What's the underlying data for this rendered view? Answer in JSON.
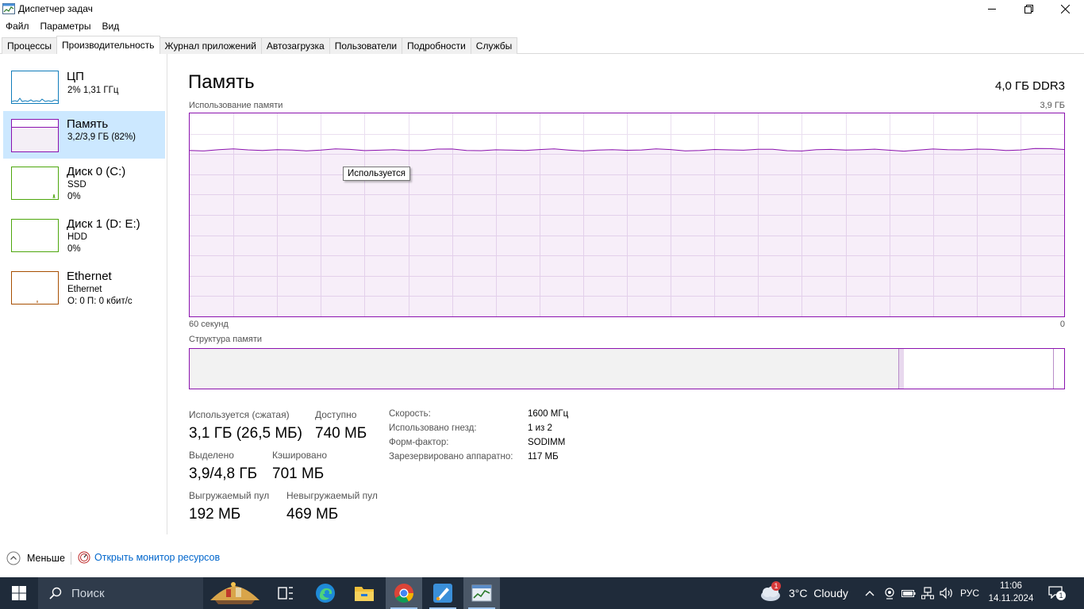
{
  "window": {
    "title": "Диспетчер задач",
    "controls": [
      "minimize-icon",
      "restore-icon",
      "close-icon"
    ]
  },
  "menu": [
    "Файл",
    "Параметры",
    "Вид"
  ],
  "tabs": [
    {
      "label": "Процессы",
      "active": false
    },
    {
      "label": "Производительность",
      "active": true
    },
    {
      "label": "Журнал приложений",
      "active": false
    },
    {
      "label": "Автозагрузка",
      "active": false
    },
    {
      "label": "Пользователи",
      "active": false
    },
    {
      "label": "Подробности",
      "active": false
    },
    {
      "label": "Службы",
      "active": false
    }
  ],
  "sidebar": {
    "items": [
      {
        "name": "ЦП",
        "line2": "2% 1,31 ГГц",
        "line3": "",
        "color": "#117dbb",
        "selected": false
      },
      {
        "name": "Память",
        "line2": "3,2/3,9 ГБ (82%)",
        "line3": "",
        "color": "#8b12ae",
        "selected": true
      },
      {
        "name": "Диск 0 (C:)",
        "line2": "SSD",
        "line3": "0%",
        "color": "#4da60c",
        "selected": false
      },
      {
        "name": "Диск 1 (D: E:)",
        "line2": "HDD",
        "line3": "0%",
        "color": "#4da60c",
        "selected": false
      },
      {
        "name": "Ethernet",
        "line2": "Ethernet",
        "line3": "О: 0 П: 0 кбит/с",
        "color": "#a74f01",
        "selected": false
      }
    ]
  },
  "memory": {
    "title": "Память",
    "total": "4,0 ГБ DDR3",
    "usage_label": "Использование памяти",
    "usage_max": "3,9 ГБ",
    "time_label": "60 секунд",
    "time_min": "0",
    "tooltip": "Используется",
    "structure_label": "Структура памяти",
    "usage_fraction": 0.82,
    "structure": {
      "in_use": 0.81,
      "modified": 0.007,
      "standby": 0.17,
      "free": 0.013
    },
    "stats": {
      "in_use_label": "Используется (сжатая)",
      "in_use": "3,1 ГБ (26,5 МБ)",
      "available_label": "Доступно",
      "available": "740 МБ",
      "committed_label": "Выделено",
      "committed": "3,9/4,8 ГБ",
      "cached_label": "Кэшировано",
      "cached": "701 МБ",
      "paged_label": "Выгружаемый пул",
      "paged": "192 МБ",
      "nonpaged_label": "Невыгружаемый пул",
      "nonpaged": "469 МБ"
    },
    "details": [
      {
        "k": "Скорость:",
        "v": "1600 МГц"
      },
      {
        "k": "Использовано гнезд:",
        "v": "1 из 2"
      },
      {
        "k": "Форм-фактор:",
        "v": "SODIMM"
      },
      {
        "k": "Зарезервировано аппаратно:",
        "v": "117 МБ"
      }
    ]
  },
  "bottom": {
    "fewer": "Меньше",
    "resmon": "Открыть монитор ресурсов"
  },
  "taskbar": {
    "search_placeholder": "Поиск",
    "apps": [
      "vacation-widget-icon",
      "task-view-icon",
      "edge-icon",
      "file-explorer-icon",
      "chrome-icon",
      "paint-icon",
      "task-manager-icon"
    ],
    "weather": "3°C  Cloudy",
    "weather_badge": "1",
    "lang": "РУС",
    "time": "11:06",
    "date": "14.11.2024",
    "notification_count": "1"
  }
}
